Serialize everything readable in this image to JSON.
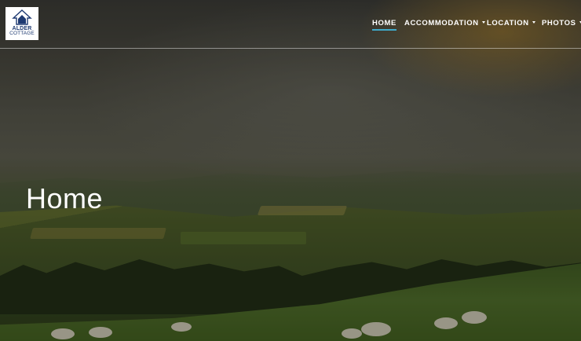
{
  "logo": {
    "line1": "ALDER",
    "line2": "COTTAGE"
  },
  "nav": {
    "home": "HOME",
    "accommodation": "ACCOMMODATION",
    "location": "LOCATION",
    "photos": "PHOTOS"
  },
  "hero": {
    "title": "Home"
  },
  "colors": {
    "brand_blue": "#1e3a72",
    "active_underline": "#3fa9c9",
    "nav_text": "#ffffff"
  }
}
